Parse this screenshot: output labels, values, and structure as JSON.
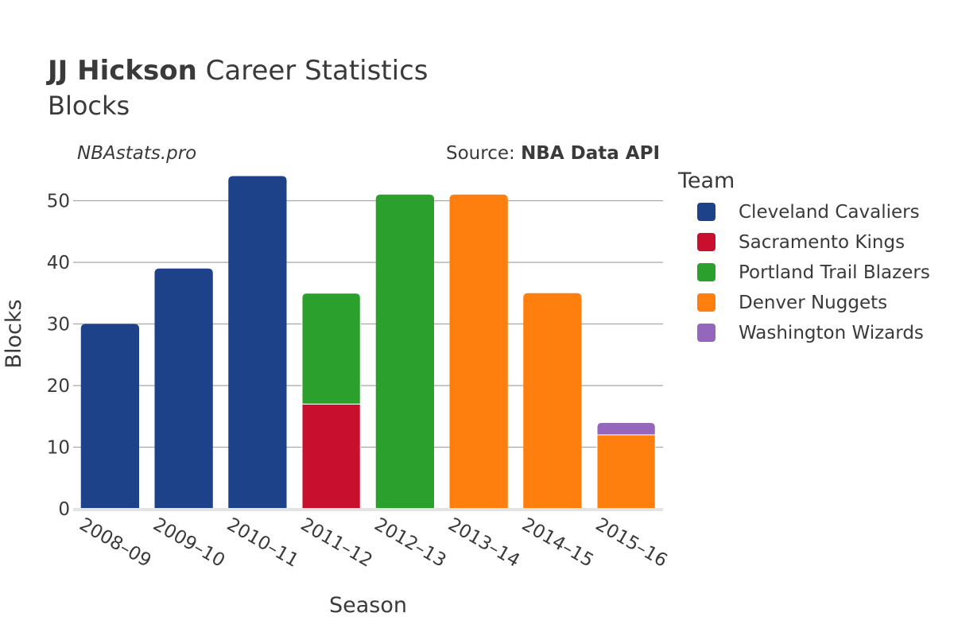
{
  "header": {
    "player_name": "JJ Hickson",
    "title_suffix": " Career Statistics",
    "subtitle": "Blocks"
  },
  "credits": {
    "site": "NBAstats.pro",
    "source_prefix": "Source: ",
    "source_name": "NBA Data API"
  },
  "chart_data": {
    "type": "bar",
    "stacked": true,
    "title": "JJ Hickson Career Statistics",
    "subtitle": "Blocks",
    "xlabel": "Season",
    "ylabel": "Blocks",
    "ylim": [
      0,
      56
    ],
    "yticks": [
      0,
      10,
      20,
      30,
      40,
      50
    ],
    "grid": true,
    "legend_title": "Team",
    "legend_position": "right",
    "categories": [
      "2008–09",
      "2009–10",
      "2010–11",
      "2011–12",
      "2012–13",
      "2013–14",
      "2014–15",
      "2015–16"
    ],
    "series": [
      {
        "name": "Cleveland Cavaliers",
        "color": "#1d428a",
        "values": [
          30,
          39,
          54,
          0,
          0,
          0,
          0,
          0
        ]
      },
      {
        "name": "Sacramento Kings",
        "color": "#c8102e",
        "values": [
          0,
          0,
          0,
          17,
          0,
          0,
          0,
          0
        ]
      },
      {
        "name": "Portland Trail Blazers",
        "color": "#2ca02c",
        "values": [
          0,
          0,
          0,
          18,
          51,
          0,
          0,
          0
        ]
      },
      {
        "name": "Denver Nuggets",
        "color": "#ff7f0e",
        "values": [
          0,
          0,
          0,
          0,
          0,
          51,
          35,
          12
        ]
      },
      {
        "name": "Washington Wizards",
        "color": "#9467bd",
        "values": [
          0,
          0,
          0,
          0,
          0,
          0,
          0,
          2
        ]
      }
    ]
  }
}
